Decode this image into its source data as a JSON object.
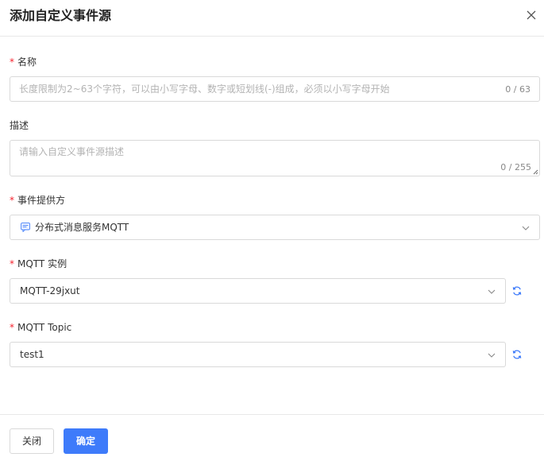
{
  "dialog": {
    "title": "添加自定义事件源",
    "close_icon": "close-icon"
  },
  "form": {
    "name": {
      "required_mark": "*",
      "label": "名称",
      "placeholder": "长度限制为2~63个字符，可以由小写字母、数字或短划线(-)组成，必须以小写字母开始",
      "counter": "0 / 63"
    },
    "description": {
      "label": "描述",
      "placeholder": "请输入自定义事件源描述",
      "counter": "0 / 255"
    },
    "provider": {
      "required_mark": "*",
      "label": "事件提供方",
      "value": "分布式消息服务MQTT",
      "icon": "message-service-icon"
    },
    "mqtt_instance": {
      "required_mark": "*",
      "label": "MQTT 实例",
      "value": "MQTT-29jxut",
      "refresh_icon": "refresh-icon"
    },
    "mqtt_topic": {
      "required_mark": "*",
      "label": "MQTT Topic",
      "value": "test1",
      "refresh_icon": "refresh-icon"
    }
  },
  "footer": {
    "close_label": "关闭",
    "confirm_label": "确定"
  },
  "colors": {
    "primary": "#3e7bfa",
    "required": "#f5222d",
    "border": "#d9d9d9",
    "placeholder": "#b3b3b3"
  }
}
